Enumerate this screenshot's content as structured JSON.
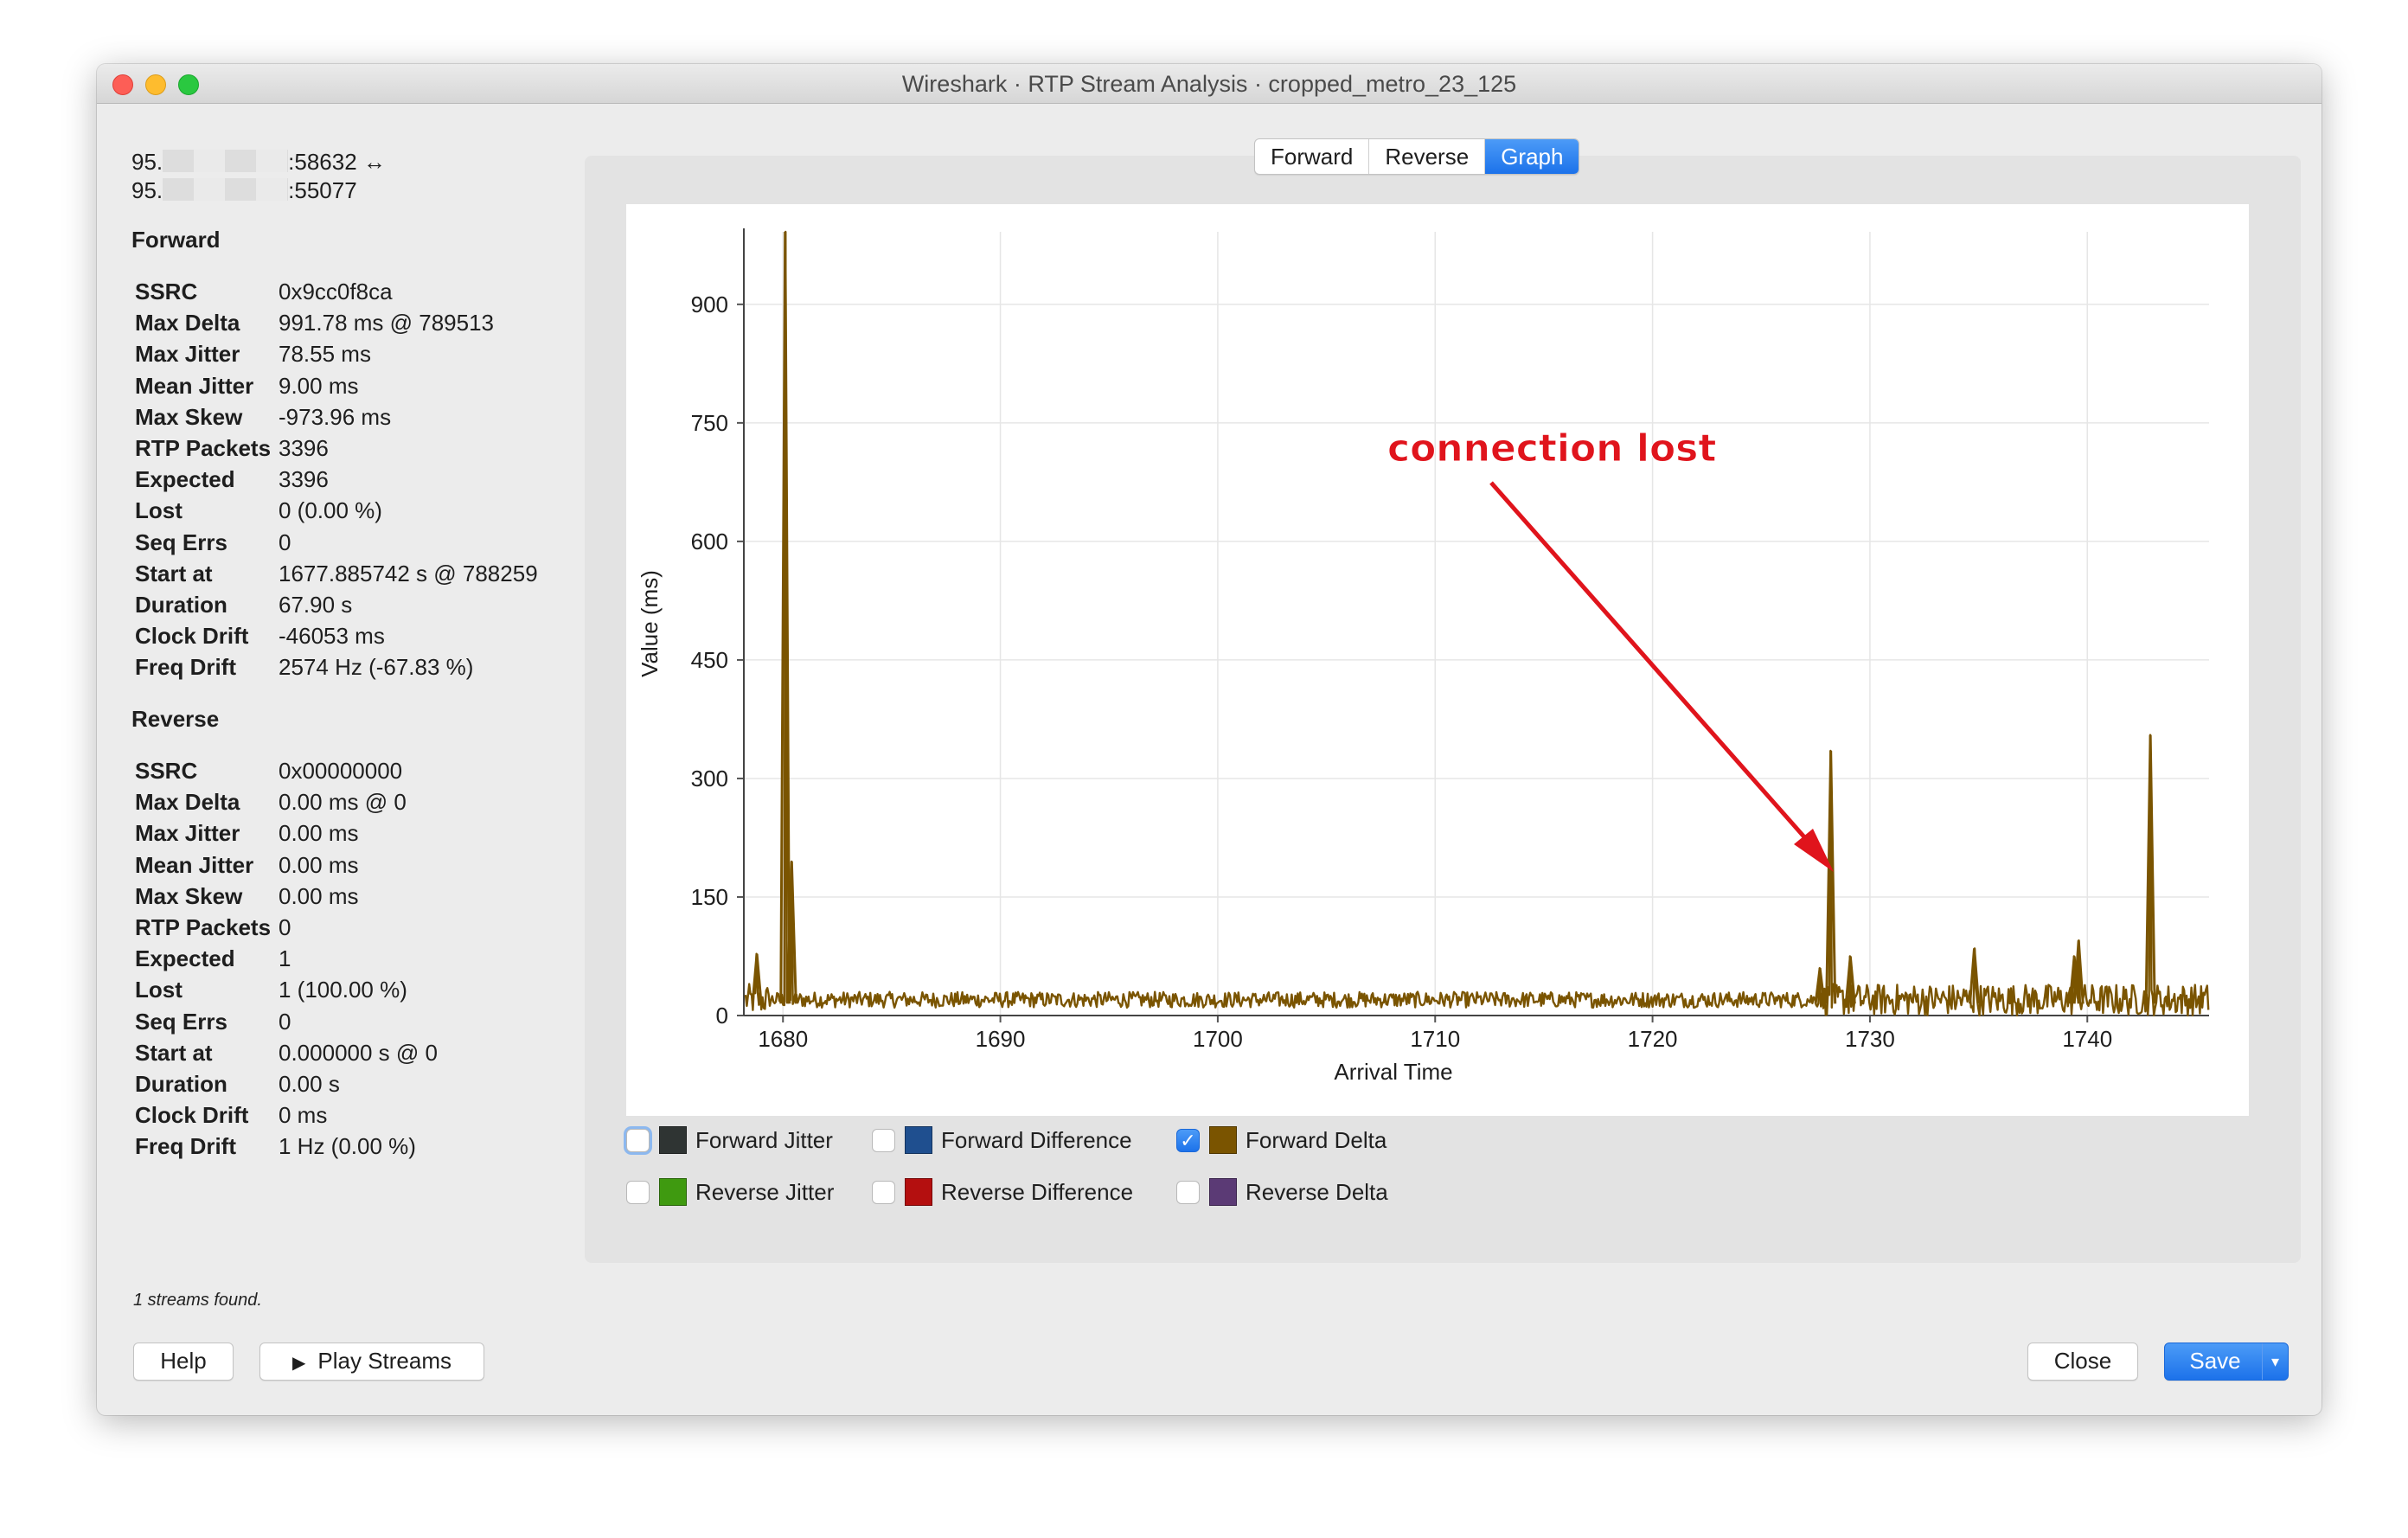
{
  "window": {
    "title": "Wireshark · RTP Stream Analysis · cropped_metro_23_125"
  },
  "connection": {
    "line1_prefix": "95.",
    "line1_suffix": ":58632 ↔",
    "line2_prefix": "95.",
    "line2_suffix": ":55077"
  },
  "forward": {
    "title": "Forward",
    "stats": [
      {
        "key": "SSRC",
        "value": "0x9cc0f8ca"
      },
      {
        "key": "Max Delta",
        "value": "991.78 ms @ 789513"
      },
      {
        "key": "Max Jitter",
        "value": "78.55 ms"
      },
      {
        "key": "Mean Jitter",
        "value": "9.00 ms"
      },
      {
        "key": "Max Skew",
        "value": "-973.96 ms"
      },
      {
        "key": "RTP Packets",
        "value": "3396"
      },
      {
        "key": "Expected",
        "value": "3396"
      },
      {
        "key": "Lost",
        "value": "0 (0.00 %)"
      },
      {
        "key": "Seq Errs",
        "value": "0"
      },
      {
        "key": "Start at",
        "value": "1677.885742 s @ 788259"
      },
      {
        "key": "Duration",
        "value": "67.90 s"
      },
      {
        "key": "Clock Drift",
        "value": "-46053 ms"
      },
      {
        "key": "Freq Drift",
        "value": "2574 Hz (-67.83 %)"
      }
    ]
  },
  "reverse": {
    "title": "Reverse",
    "stats": [
      {
        "key": "SSRC",
        "value": "0x00000000"
      },
      {
        "key": "Max Delta",
        "value": "0.00 ms @ 0"
      },
      {
        "key": "Max Jitter",
        "value": "0.00 ms"
      },
      {
        "key": "Mean Jitter",
        "value": "0.00 ms"
      },
      {
        "key": "Max Skew",
        "value": "0.00 ms"
      },
      {
        "key": "RTP Packets",
        "value": "0"
      },
      {
        "key": "Expected",
        "value": "1"
      },
      {
        "key": "Lost",
        "value": "1 (100.00 %)"
      },
      {
        "key": "Seq Errs",
        "value": "0"
      },
      {
        "key": "Start at",
        "value": "0.000000 s @ 0"
      },
      {
        "key": "Duration",
        "value": "0.00 s"
      },
      {
        "key": "Clock Drift",
        "value": "0 ms"
      },
      {
        "key": "Freq Drift",
        "value": "1 Hz (0.00 %)"
      }
    ]
  },
  "tabs": [
    {
      "label": "Forward",
      "active": false
    },
    {
      "label": "Reverse",
      "active": false
    },
    {
      "label": "Graph",
      "active": true
    }
  ],
  "annotation": {
    "text": "connection lost",
    "color": "#e0141c"
  },
  "legend": [
    {
      "label": "Forward Jitter",
      "color": "#2f3433",
      "checked": false
    },
    {
      "label": "Forward Difference",
      "color": "#1f4f8f",
      "checked": false
    },
    {
      "label": "Forward Delta",
      "color": "#7a5400",
      "checked": true
    },
    {
      "label": "Reverse Jitter",
      "color": "#3f9a10",
      "checked": false
    },
    {
      "label": "Reverse Difference",
      "color": "#b40f0f",
      "checked": false
    },
    {
      "label": "Reverse Delta",
      "color": "#5b3a75",
      "checked": false
    }
  ],
  "status": "1 streams found.",
  "buttons": {
    "help": "Help",
    "play": "Play Streams",
    "play_icon": "▶",
    "close": "Close",
    "save": "Save",
    "save_caret": "▾"
  },
  "chart_data": {
    "type": "line",
    "xlabel": "Arrival Time",
    "ylabel": "Value (ms)",
    "xlim": [
      1678.2,
      1745.6
    ],
    "ylim": [
      0,
      991.78
    ],
    "x_ticks": [
      1680,
      1690,
      1700,
      1710,
      1720,
      1730,
      1740
    ],
    "y_ticks": [
      0,
      150,
      300,
      450,
      600,
      750,
      900
    ],
    "grid": true,
    "series": [
      {
        "name": "Forward Delta",
        "color": "#7a5400",
        "baseline_band_before_loss": [
          10,
          30
        ],
        "baseline_band_after_loss": [
          0,
          40
        ],
        "spikes": [
          {
            "x": 1678.8,
            "y": 78
          },
          {
            "x": 1680.1,
            "y": 991.78
          },
          {
            "x": 1680.4,
            "y": 195
          },
          {
            "x": 1727.7,
            "y": 60
          },
          {
            "x": 1728.2,
            "y": 335
          },
          {
            "x": 1729.1,
            "y": 75
          },
          {
            "x": 1734.8,
            "y": 85
          },
          {
            "x": 1739.4,
            "y": 75
          },
          {
            "x": 1739.6,
            "y": 95
          },
          {
            "x": 1742.9,
            "y": 355
          }
        ]
      }
    ]
  }
}
